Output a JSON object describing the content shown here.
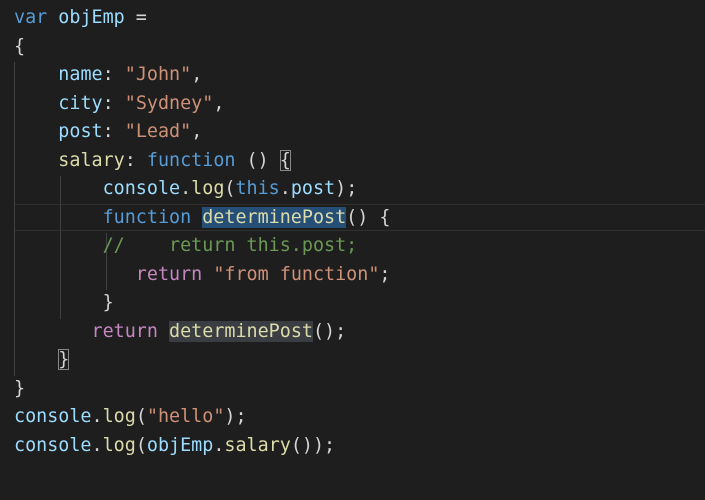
{
  "editor": {
    "lines": [
      {
        "tokens": [
          {
            "t": "var",
            "c": "kw"
          },
          {
            "t": " ",
            "c": "punc"
          },
          {
            "t": "objEmp",
            "c": "var"
          },
          {
            "t": " =",
            "c": "punc"
          }
        ]
      },
      {
        "tokens": [
          {
            "t": "{",
            "c": "punc"
          }
        ]
      },
      {
        "tokens": [
          {
            "t": "    ",
            "c": "punc"
          },
          {
            "t": "name",
            "c": "var"
          },
          {
            "t": ": ",
            "c": "punc"
          },
          {
            "t": "\"John\"",
            "c": "str"
          },
          {
            "t": ",",
            "c": "punc"
          }
        ]
      },
      {
        "tokens": [
          {
            "t": "    ",
            "c": "punc"
          },
          {
            "t": "city",
            "c": "var"
          },
          {
            "t": ": ",
            "c": "punc"
          },
          {
            "t": "\"Sydney\"",
            "c": "str"
          },
          {
            "t": ",",
            "c": "punc"
          }
        ]
      },
      {
        "tokens": [
          {
            "t": "    ",
            "c": "punc"
          },
          {
            "t": "post",
            "c": "var"
          },
          {
            "t": ": ",
            "c": "punc"
          },
          {
            "t": "\"Lead\"",
            "c": "str"
          },
          {
            "t": ",",
            "c": "punc"
          }
        ]
      },
      {
        "tokens": [
          {
            "t": "    ",
            "c": "punc"
          },
          {
            "t": "salary",
            "c": "fn"
          },
          {
            "t": ": ",
            "c": "punc"
          },
          {
            "t": "function",
            "c": "kw"
          },
          {
            "t": " () ",
            "c": "punc"
          },
          {
            "t": "{",
            "c": "punc bracket-match"
          }
        ]
      },
      {
        "tokens": [
          {
            "t": "        ",
            "c": "punc"
          },
          {
            "t": "console",
            "c": "var"
          },
          {
            "t": ".",
            "c": "punc"
          },
          {
            "t": "log",
            "c": "fn"
          },
          {
            "t": "(",
            "c": "punc"
          },
          {
            "t": "this",
            "c": "kw"
          },
          {
            "t": ".",
            "c": "punc"
          },
          {
            "t": "post",
            "c": "var"
          },
          {
            "t": ");",
            "c": "punc"
          }
        ]
      },
      {
        "tokens": [
          {
            "t": "        ",
            "c": "punc"
          },
          {
            "t": "function",
            "c": "kw"
          },
          {
            "t": " ",
            "c": "punc"
          },
          {
            "t": "determinePost",
            "c": "fn hl-sel"
          },
          {
            "t": "() {",
            "c": "punc"
          }
        ]
      },
      {
        "tokens": [
          {
            "t": "        ",
            "c": "punc"
          },
          {
            "t": "//    return this.post;",
            "c": "cmt"
          }
        ]
      },
      {
        "tokens": [
          {
            "t": "           ",
            "c": "punc"
          },
          {
            "t": "return",
            "c": "ctl"
          },
          {
            "t": " ",
            "c": "punc"
          },
          {
            "t": "\"from function\"",
            "c": "str"
          },
          {
            "t": ";",
            "c": "punc"
          }
        ]
      },
      {
        "tokens": [
          {
            "t": "        ",
            "c": "punc"
          },
          {
            "t": "}",
            "c": "punc"
          }
        ]
      },
      {
        "tokens": [
          {
            "t": "       ",
            "c": "punc"
          },
          {
            "t": "return",
            "c": "ctl"
          },
          {
            "t": " ",
            "c": "punc"
          },
          {
            "t": "determinePost",
            "c": "fn hl-word"
          },
          {
            "t": "();",
            "c": "punc"
          }
        ]
      },
      {
        "tokens": [
          {
            "t": "    ",
            "c": "punc"
          },
          {
            "t": "}",
            "c": "punc bracket-match"
          }
        ]
      },
      {
        "tokens": [
          {
            "t": "}",
            "c": "punc"
          }
        ]
      },
      {
        "tokens": [
          {
            "t": "console",
            "c": "var"
          },
          {
            "t": ".",
            "c": "punc"
          },
          {
            "t": "log",
            "c": "fn"
          },
          {
            "t": "(",
            "c": "punc"
          },
          {
            "t": "\"hello\"",
            "c": "str"
          },
          {
            "t": ");",
            "c": "punc"
          }
        ]
      },
      {
        "tokens": [
          {
            "t": "console",
            "c": "var"
          },
          {
            "t": ".",
            "c": "punc"
          },
          {
            "t": "log",
            "c": "fn"
          },
          {
            "t": "(",
            "c": "punc"
          },
          {
            "t": "objEmp",
            "c": "var"
          },
          {
            "t": ".",
            "c": "punc"
          },
          {
            "t": "salary",
            "c": "fn"
          },
          {
            "t": "());",
            "c": "punc"
          }
        ]
      }
    ]
  },
  "colors": {
    "background": "#1e1e1e",
    "keyword": "#569cd6",
    "variable": "#9cdcfe",
    "string": "#ce9178",
    "function": "#dcdcaa",
    "control": "#c586c0",
    "comment": "#6a9955",
    "selection": "#264f78"
  }
}
